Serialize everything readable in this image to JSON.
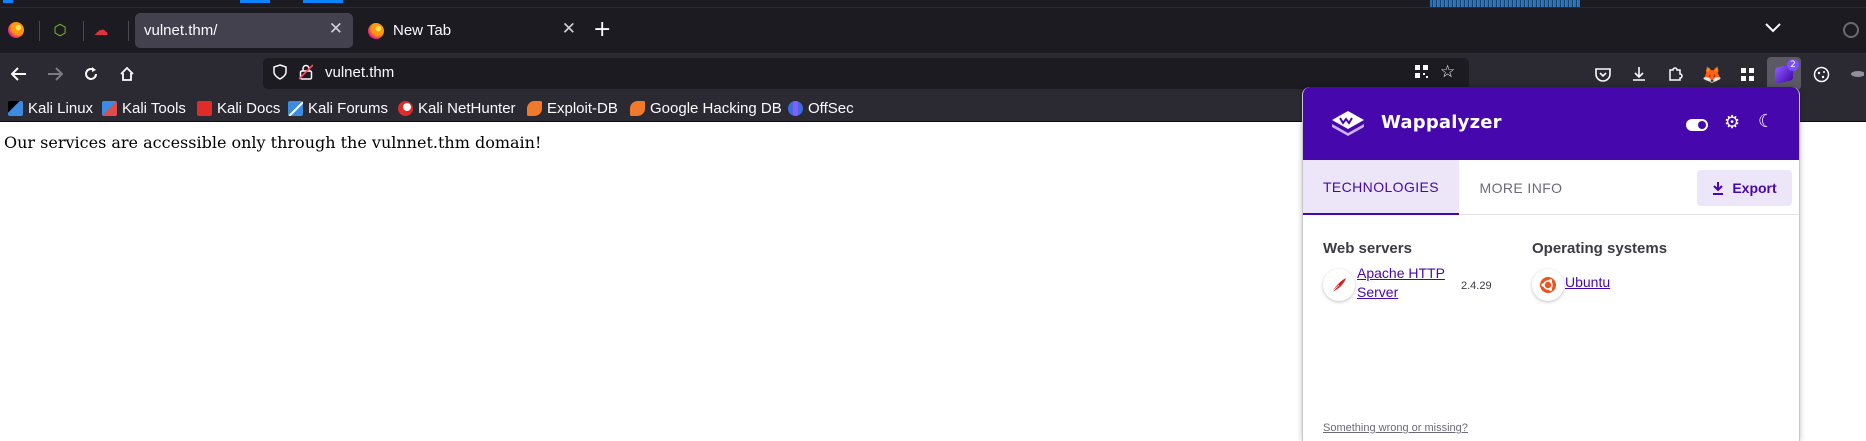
{
  "tabs": [
    {
      "title": "vulnet.thm/",
      "active": true
    },
    {
      "title": "New Tab",
      "active": false
    }
  ],
  "urlbar": {
    "url": "vulnet.thm"
  },
  "bookmarks": [
    {
      "label": "Kali Linux",
      "color": "#3d8be0"
    },
    {
      "label": "Kali Tools",
      "color": "#e04b4b"
    },
    {
      "label": "Kali Docs",
      "color": "#e02b2b"
    },
    {
      "label": "Kali Forums",
      "color": "#3d8be0"
    },
    {
      "label": "Kali NetHunter",
      "color": "#e02b2b"
    },
    {
      "label": "Exploit-DB",
      "color": "#f0792b"
    },
    {
      "label": "Google Hacking DB",
      "color": "#f0792b"
    },
    {
      "label": "OffSec",
      "color": "#3d6be0"
    }
  ],
  "page": {
    "message": "Our services are accessible only through the vulnnet.thm domain!"
  },
  "extension": {
    "badge": "2"
  },
  "wappalyzer": {
    "brand": "Wappalyzer",
    "accent": "#4608ad",
    "tabs": {
      "technologies": "TECHNOLOGIES",
      "more_info": "MORE INFO"
    },
    "export_label": "Export",
    "categories": [
      {
        "name": "Web servers",
        "tech": {
          "line1": "Apache HTTP",
          "line2": "Server",
          "version": "2.4.29"
        }
      },
      {
        "name": "Operating systems",
        "tech": {
          "line1": "Ubuntu",
          "line2": "",
          "version": ""
        }
      }
    ],
    "footer": "Something wrong or missing?"
  }
}
